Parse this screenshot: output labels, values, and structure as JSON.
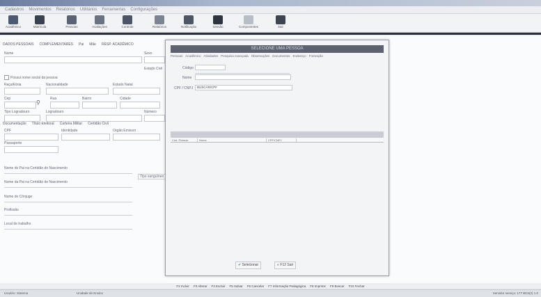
{
  "menu": [
    "Cadastros",
    "Movimentos",
    "Relatórios",
    "Utilitários",
    "Ferramentas",
    "Configurações"
  ],
  "toolbar": [
    {
      "label": "Acadêmico",
      "icon": "student-icon",
      "color": "#4b5a72"
    },
    {
      "label": "Matrícula",
      "icon": "folder-icon",
      "color": "#3a4250"
    },
    {
      "label": "Pessoas",
      "icon": "people-icon",
      "color": "#5a6373"
    },
    {
      "label": "Avaliações",
      "icon": "grid-icon",
      "color": "#6b7383"
    },
    {
      "label": "Controle",
      "icon": "document-icon",
      "color": "#4c5566"
    },
    {
      "label": "Relatórios",
      "icon": "chart-icon",
      "color": "#7b8493"
    },
    {
      "label": "Notificação",
      "icon": "printer-icon",
      "color": "#4e5664"
    },
    {
      "label": "Sessão",
      "icon": "web-icon",
      "color": "#2f3540"
    },
    {
      "label": "Componentes",
      "icon": "satellite-icon",
      "color": "#b8bec8"
    },
    {
      "label": "Sair",
      "icon": "exit-icon",
      "color": "#3e4450"
    }
  ],
  "tabs": [
    "DADOS PESSOAIS",
    "COMPLEMENTARES",
    "Pai",
    "Mãe",
    "RESP. ACADÊMICO"
  ],
  "fields": {
    "nome": "Nome",
    "sexo": "Sexo",
    "estado_civil": "Estado Civil",
    "possui_nome_social": "Possui nome social da pessoa",
    "raca": "Raça/Etnia",
    "nacionalidade": "Nacionalidade",
    "estado": "Estado Natal",
    "cidade": "Cidade",
    "cep": "Cep",
    "rua": "Rua",
    "bairro": "Bairro",
    "cidade2": "Cidade",
    "tipo_logradouro": "Tipo Logradouro",
    "logradouro": "Logradouro",
    "numero": "Número",
    "doc_tabs": [
      "Documentação",
      "Título Eleitoral",
      "Carteira Militar",
      "Certidão Civil"
    ],
    "cpf": "CPF",
    "identidade": "Identidade",
    "orgao": "Orgão Emissor",
    "passaporte": "Passaporte",
    "nome_pai": "Nome do Pai na Certidão de Nascimento",
    "nome_mae": "Nome da Pai na Certidão de Nascimento",
    "nome_conjuge": "Nome do Cônjuge",
    "profissao": "Profissão",
    "local_trabalho": "Local de trabalho",
    "tipo_sangue": "Tipo sanguíneo"
  },
  "modal": {
    "title": "SELECIONE UMA PESSOA",
    "tabs": [
      "Pessoas",
      "Acadêmico",
      "Atividades",
      "Pesquisa Avançada",
      "Observações",
      "Documentos",
      "Endereço",
      "Formação"
    ],
    "codigo_label": "Código",
    "nome_label": "Nome",
    "cpf_label": "CPF / CNPJ",
    "cpf_value": "BUSCAR/CPF",
    "band": "",
    "columns": [
      "Cód. Pessoa",
      "Nome",
      "CPF/CNPJ"
    ],
    "ok_label": "Selecionar",
    "cancel_label": "F12 Sair"
  },
  "fkeys": [
    "F2 Incluir",
    "F3 Alterar",
    "F4 Excluir",
    "F5 Salvar",
    "F6 Cancelar",
    "F7 Informação Pedagógica",
    "F8 Imprimir",
    "F9 Buscar",
    "F10 Fechar"
  ],
  "status": {
    "user": "Usuário: Sistema",
    "unit": "Unidade de Ensino",
    "server": "Servidor serviço: 177 BD3(2) 1.0"
  }
}
